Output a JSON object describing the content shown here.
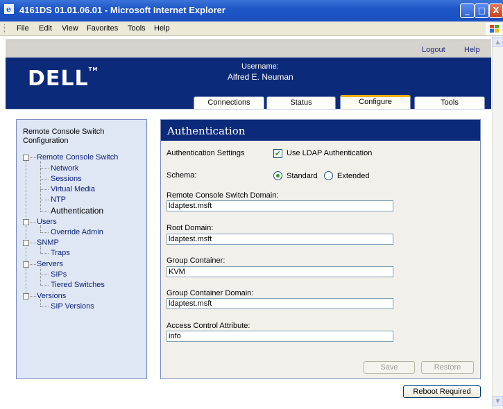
{
  "window": {
    "title": "4161DS 01.01.06.01 - Microsoft Internet Explorer",
    "buttons": {
      "minimize": "_",
      "maximize": "□",
      "close": "X"
    }
  },
  "menu": [
    "File",
    "Edit",
    "View",
    "Favorites",
    "Tools",
    "Help"
  ],
  "top_links": {
    "logout": "Logout",
    "help": "Help"
  },
  "header": {
    "logo": "DELL",
    "logo_tm": "TM",
    "username_label": "Username:",
    "username": "Alfred E. Neuman"
  },
  "tabs": [
    {
      "label": "Connections"
    },
    {
      "label": "Status"
    },
    {
      "label": "Configure",
      "active": true
    },
    {
      "label": "Tools"
    }
  ],
  "tree": {
    "title": "Remote Console Switch Configuration",
    "items": {
      "rcs": "Remote Console Switch",
      "network": "Network",
      "sessions": "Sessions",
      "virtual_media": "Virtual Media",
      "ntp": "NTP",
      "authentication": "Authentication",
      "users": "Users",
      "override_admin": "Override Admin",
      "snmp": "SNMP",
      "traps": "Traps",
      "servers": "Servers",
      "sips": "SIPs",
      "tiered_switches": "Tiered Switches",
      "versions": "Versions",
      "sip_versions": "SIP Versions"
    },
    "selected": "authentication"
  },
  "auth": {
    "title": "Authentication",
    "settings_label": "Authentication Settings",
    "use_ldap_label": "Use LDAP Authentication",
    "use_ldap_checked": true,
    "schema_label": "Schema:",
    "schema_standard": "Standard",
    "schema_extended": "Extended",
    "schema_selected": "Standard",
    "rcs_domain_label": "Remote Console Switch Domain:",
    "rcs_domain_value": "ldaptest.msft",
    "root_domain_label": "Root Domain:",
    "root_domain_value": "ldaptest.msft",
    "group_container_label": "Group Container:",
    "group_container_value": "KVM",
    "group_container_domain_label": "Group Container Domain:",
    "group_container_domain_value": "ldaptest.msft",
    "access_control_label": "Access Control Attribute:",
    "access_control_value": "info",
    "save": "Save",
    "restore": "Restore"
  },
  "reboot_button": "Reboot Required",
  "scrollbar": {
    "up": "▲",
    "down": "▼"
  },
  "colors": {
    "header_blue": "#0b2b7a",
    "tree_bg": "#dfe6f4",
    "active_tab_accent": "#f0b000",
    "check_green": "#21a121"
  }
}
